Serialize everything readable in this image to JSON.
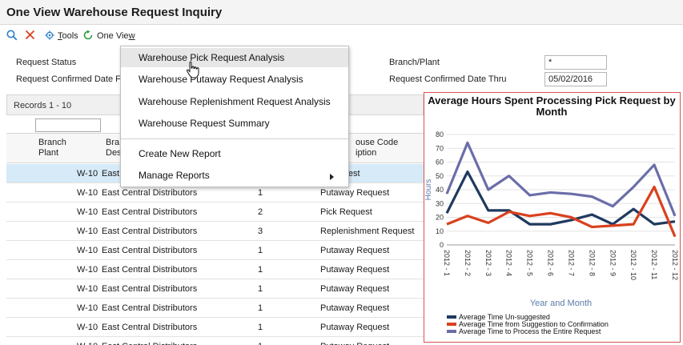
{
  "page": {
    "title": "One View Warehouse Request Inquiry"
  },
  "toolbar": {
    "tools_label": "Tools",
    "tools_accesskey": "T",
    "tools_rest": "ools",
    "oneview_label": "One View",
    "oneview_head": "One Vie",
    "oneview_accesskey": "w"
  },
  "criteria": {
    "request_status_label": "Request Status",
    "request_confirmed_from_label": "Request Confirmed Date Fro",
    "branch_plant_label": "Branch/Plant",
    "branch_plant_value": "*",
    "request_confirmed_thru_label": "Request Confirmed Date Thru",
    "request_confirmed_thru_value": "05/02/2016"
  },
  "grid": {
    "records_label": "Records 1 - 10",
    "columns": {
      "branch_plant_1": "Branch",
      "branch_plant_2": "Plant",
      "branch_desc_1": "Bra",
      "branch_desc_2": "Des",
      "request_type_1": "ouse Code",
      "request_type_2": "iption"
    },
    "rows": [
      {
        "plant": "W-10",
        "desc": "East",
        "code": "",
        "type": "y Request"
      },
      {
        "plant": "W-10",
        "desc": "East Central Distributors",
        "code": "1",
        "type": "Putaway Request"
      },
      {
        "plant": "W-10",
        "desc": "East Central Distributors",
        "code": "2",
        "type": "Pick Request"
      },
      {
        "plant": "W-10",
        "desc": "East Central Distributors",
        "code": "3",
        "type": "Replenishment Request"
      },
      {
        "plant": "W-10",
        "desc": "East Central Distributors",
        "code": "1",
        "type": "Putaway Request"
      },
      {
        "plant": "W-10",
        "desc": "East Central Distributors",
        "code": "1",
        "type": "Putaway Request"
      },
      {
        "plant": "W-10",
        "desc": "East Central Distributors",
        "code": "1",
        "type": "Putaway Request"
      },
      {
        "plant": "W-10",
        "desc": "East Central Distributors",
        "code": "1",
        "type": "Putaway Request"
      },
      {
        "plant": "W-10",
        "desc": "East Central Distributors",
        "code": "1",
        "type": "Putaway Request"
      },
      {
        "plant": "W-10",
        "desc": "East Central Distributors",
        "code": "1",
        "type": "Putaway Request"
      }
    ]
  },
  "menu": {
    "items": [
      "Warehouse Pick Request Analysis",
      "Warehouse Putaway Request Analysis",
      "Warehouse Replenishment Request Analysis",
      "Warehouse Request Summary"
    ],
    "create_new_report": "Create New Report",
    "manage_reports": "Manage Reports"
  },
  "chart_data": {
    "type": "line",
    "title": "Average Hours Spent Processing Pick Request by Month",
    "xlabel": "Year and Month",
    "ylabel": "Hours",
    "ylim": [
      0,
      80
    ],
    "yticks": [
      "0",
      "10",
      "20",
      "30",
      "40",
      "50",
      "60",
      "70",
      "80"
    ],
    "categories": [
      "2012 - 1",
      "2012 - 2",
      "2012 - 3",
      "2012 - 4",
      "2012 - 5",
      "2012 - 6",
      "2012 - 7",
      "2012 - 8",
      "2012 - 9",
      "2012 - 10",
      "2012 - 11",
      "2012 - 12"
    ],
    "series": [
      {
        "name": "Average Time Un-suggested",
        "color": "#1f3a5f",
        "values": [
          23,
          53,
          25,
          25,
          15,
          15,
          18,
          22,
          15,
          26,
          15,
          17
        ]
      },
      {
        "name": "Average Time from Suggestion to Confirmation",
        "color": "#d9411e",
        "values": [
          15,
          21,
          16,
          24,
          21,
          23,
          20,
          13,
          14,
          15,
          42,
          6
        ]
      },
      {
        "name": "Average Time to Process the Entire Request",
        "color": "#6b6ea8",
        "values": [
          37,
          74,
          40,
          50,
          36,
          38,
          37,
          35,
          28,
          42,
          58,
          21
        ]
      }
    ]
  }
}
